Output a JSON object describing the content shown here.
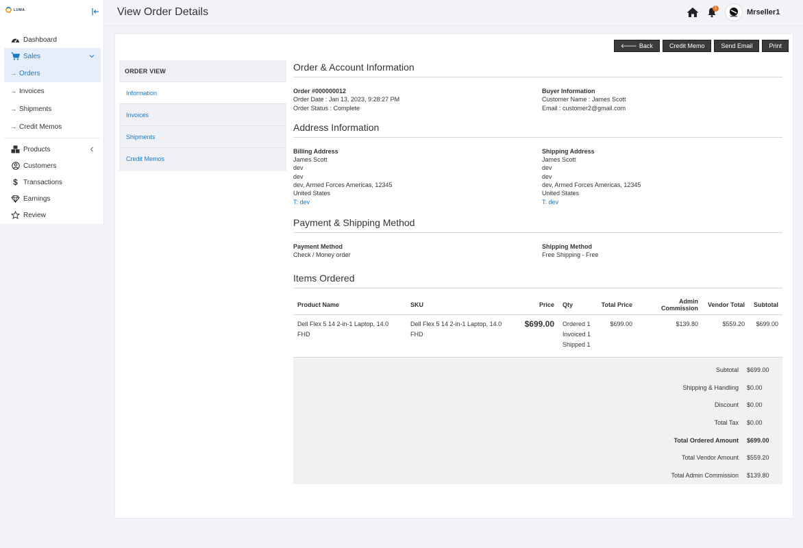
{
  "brand": {
    "logo_text": "LUMA"
  },
  "sidebar": {
    "items": [
      {
        "label": "Dashboard"
      },
      {
        "label": "Sales"
      },
      {
        "label": "Products"
      },
      {
        "label": "Customers"
      },
      {
        "label": "Transactions"
      },
      {
        "label": "Earnings"
      },
      {
        "label": "Review"
      }
    ],
    "sales_sub": [
      {
        "label": "Orders"
      },
      {
        "label": "Invoices"
      },
      {
        "label": "Shipments"
      },
      {
        "label": "Credit Memos"
      }
    ]
  },
  "header": {
    "title": "View Order Details",
    "notification_count": "1",
    "username": "Mrseller1"
  },
  "toolbar": {
    "back": "Back",
    "credit_memo": "Credit Memo",
    "send_email": "Send Email",
    "print": "Print"
  },
  "order_view": {
    "heading": "ORDER VIEW",
    "tabs": [
      "Information",
      "Invoices",
      "Shipments",
      "Credit Memos"
    ]
  },
  "order_account": {
    "title": "Order & Account Information",
    "order_no": "Order #000000012",
    "order_date": "Order Date : Jan 13, 2023, 9:28:27 PM",
    "order_status": "Order Status : Complete",
    "buyer_heading": "Buyer Information",
    "customer_name": "Customer Name : James Scott",
    "email": "Email : customer2@gmail.com"
  },
  "address": {
    "title": "Address Information",
    "billing": {
      "heading": "Billing Address",
      "name": "James Scott",
      "line1": "dev",
      "line2": "dev",
      "city": "dev, Armed Forces Americas, 12345",
      "country": "United States",
      "tel_prefix": "T: ",
      "tel": "dev"
    },
    "shipping": {
      "heading": "Shipping Address",
      "name": "James Scott",
      "line1": "dev",
      "line2": "dev",
      "city": "dev, Armed Forces Americas, 12345",
      "country": "United States",
      "tel_prefix": "T: ",
      "tel": "dev"
    }
  },
  "payment": {
    "title": "Payment & Shipping Method",
    "payment_heading": "Payment Method",
    "payment_value": "Check / Money order",
    "shipping_heading": "Shipping Method",
    "shipping_value": "Free Shipping - Free"
  },
  "items": {
    "title": "Items Ordered",
    "headers": [
      "Product Name",
      "SKU",
      "Price",
      "Qty",
      "Total Price",
      "Admin Commission",
      "Vendor Total",
      "Subtotal"
    ],
    "rows": [
      {
        "product": "Dell Flex 5 14 2-in-1 Laptop, 14.0 FHD",
        "sku": "Dell Flex 5 14 2-in-1 Laptop, 14.0 FHD",
        "price": "$699.00",
        "qty_ordered": "Ordered 1",
        "qty_invoiced": "Invoiced 1",
        "qty_shipped": "Shipped 1",
        "total_price": "$699.00",
        "admin_commission": "$139.80",
        "vendor_total": "$559.20",
        "subtotal": "$699.00"
      }
    ]
  },
  "totals": [
    {
      "label": "Subtotal",
      "value": "$699.00"
    },
    {
      "label": "Shipping & Handling",
      "value": "$0.00"
    },
    {
      "label": "Discount",
      "value": "$0.00"
    },
    {
      "label": "Total Tax",
      "value": "$0.00"
    },
    {
      "label": "Total Ordered Amount",
      "value": "$699.00"
    },
    {
      "label": "Total Vendor Amount",
      "value": "$559.20"
    },
    {
      "label": "Total Admin Commission",
      "value": "$139.80"
    }
  ],
  "colors": {
    "accent": "#1979c3",
    "dark_button": "#3b3b3b",
    "badge": "#e8782a"
  }
}
